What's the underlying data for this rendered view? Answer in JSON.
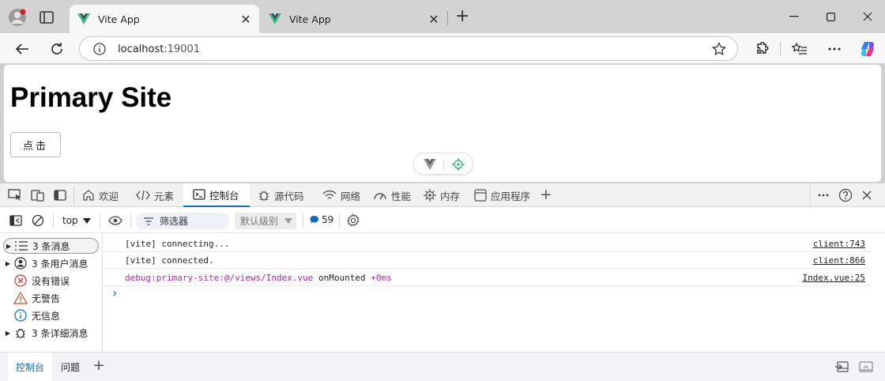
{
  "browser": {
    "tabs": [
      {
        "title": "Vite App",
        "close": "✕"
      },
      {
        "title": "Vite App",
        "close": "✕"
      }
    ],
    "new_tab": "+",
    "address": {
      "host": "localhost",
      "port": ":19001"
    },
    "colors": {
      "accent": "#0f6cbd",
      "vue_green": "#41b883",
      "vue_dark": "#34495e"
    }
  },
  "page": {
    "title": "Primary Site",
    "button_label": "点击"
  },
  "devtools": {
    "tabs": [
      {
        "label": "欢迎",
        "icon": "home-icon"
      },
      {
        "label": "元素",
        "icon": "code-icon"
      },
      {
        "label": "控制台",
        "icon": "console-icon"
      },
      {
        "label": "源代码",
        "icon": "bug-icon"
      },
      {
        "label": "网络",
        "icon": "wifi-icon"
      },
      {
        "label": "性能",
        "icon": "gauge-icon"
      },
      {
        "label": "内存",
        "icon": "chip-icon"
      },
      {
        "label": "应用程序",
        "icon": "app-window-icon"
      }
    ],
    "add_tab": "+",
    "toolbar": {
      "context": "top",
      "filter_placeholder": "筛选器",
      "level": "默认级别",
      "issues_count": "59"
    },
    "sidebar": [
      {
        "label": "3 条消息",
        "icon": "list-icon",
        "arrow": "▶"
      },
      {
        "label": "3 条用户消息",
        "icon": "user-icon",
        "arrow": "▶"
      },
      {
        "label": "没有错误",
        "icon": "error-icon",
        "arrow": ""
      },
      {
        "label": "无警告",
        "icon": "warning-icon",
        "arrow": ""
      },
      {
        "label": "无信息",
        "icon": "info-icon",
        "arrow": ""
      },
      {
        "label": "3 条详细消息",
        "icon": "bug-icon",
        "arrow": "▶"
      }
    ],
    "logs": [
      {
        "msg": "[vite] connecting...",
        "src": "client:743"
      },
      {
        "msg": "[vite] connected.",
        "src": "client:866"
      },
      {
        "msg_a": "debug:primary-site:@/views/Index.vue",
        "msg_b": " onMounted ",
        "msg_c": "+0ms",
        "src": "Index.vue:25"
      }
    ],
    "prompt": "›",
    "drawer": {
      "console": "控制台",
      "issues": "问题",
      "add": "+"
    }
  }
}
